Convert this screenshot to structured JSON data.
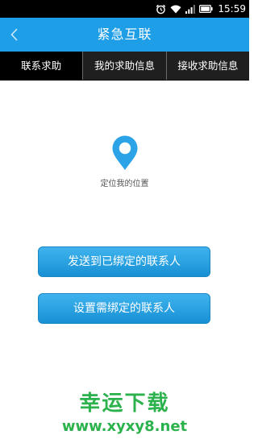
{
  "status_bar": {
    "time": "15:59",
    "icons": [
      "alarm-icon",
      "wifi-icon",
      "signal-icon",
      "battery-icon"
    ]
  },
  "title_bar": {
    "back_icon": "chevron-left-icon",
    "title": "紧急互联"
  },
  "tabs": [
    {
      "label": "联系求助",
      "active": true
    },
    {
      "label": "我的求助信息",
      "active": false
    },
    {
      "label": "接收求助信息",
      "active": false
    }
  ],
  "locate": {
    "icon": "map-pin-icon",
    "label": "定位我的位置"
  },
  "buttons": {
    "send_to_contacts": "发送到已绑定的联系人",
    "setup_contacts": "设置需绑定的联系人"
  },
  "watermark": {
    "title": "幸运下载",
    "url": "www.xyxy8.net"
  },
  "colors": {
    "title_bar": "#1e9ee6",
    "tab_bar": "#1f1f1f",
    "button": "#1f9ce0",
    "pin": "#2ba3e6",
    "watermark": "#2bb24c"
  }
}
